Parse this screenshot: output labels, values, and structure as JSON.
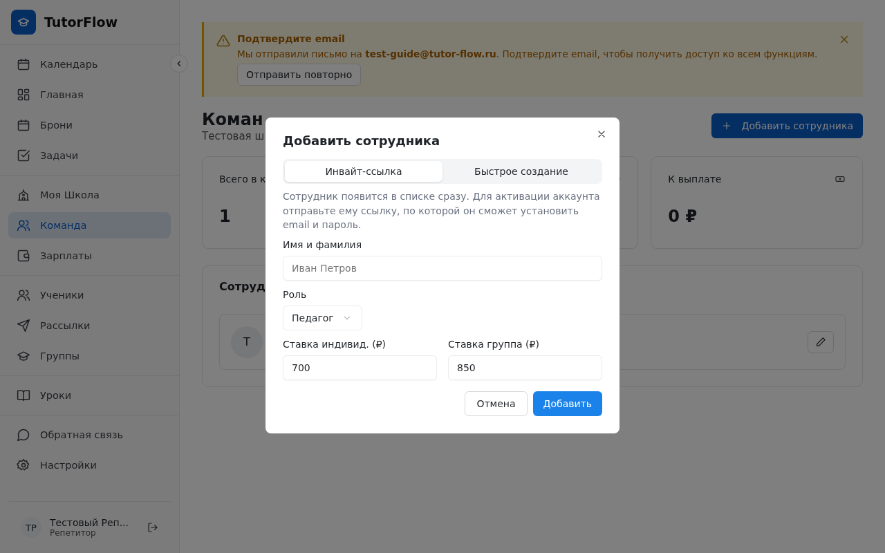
{
  "app": {
    "name": "TutorFlow"
  },
  "sidebar": {
    "sections": [
      {
        "items": [
          {
            "label": "Календарь",
            "selected": false
          },
          {
            "label": "Главная",
            "selected": false
          },
          {
            "label": "Брони",
            "selected": false
          },
          {
            "label": "Задачи",
            "selected": false
          }
        ]
      },
      {
        "items": [
          {
            "label": "Моя Школа",
            "selected": false
          },
          {
            "label": "Команда",
            "selected": true
          },
          {
            "label": "Зарплаты",
            "selected": false
          }
        ]
      },
      {
        "items": [
          {
            "label": "Ученики",
            "selected": false
          },
          {
            "label": "Рассылки",
            "selected": false
          },
          {
            "label": "Группы",
            "selected": false
          }
        ]
      },
      {
        "items": [
          {
            "label": "Уроки",
            "selected": false
          }
        ]
      },
      {
        "items": [
          {
            "label": "Обратная связь",
            "selected": false
          },
          {
            "label": "Настройки",
            "selected": false
          }
        ]
      }
    ],
    "user": {
      "initials": "TP",
      "name": "Тестовый Реп...",
      "role": "Репетитор"
    }
  },
  "banner": {
    "title": "Подтвердите email",
    "message": "Мы отправили письмо на **test-guide@tutor-flow.ru**. Подтвердите email, чтобы получить доступ ко всем функциям.",
    "button": "Отправить повторно"
  },
  "page": {
    "title": "Коман",
    "subtitle": "Тестовая ш",
    "add_button": "Добавить сотрудника"
  },
  "stats": [
    {
      "kind": "metric",
      "label": "Всего в к",
      "value": "1"
    },
    {
      "kind": "covered"
    },
    {
      "kind": "metric",
      "label": "К выплате",
      "value": "0 ₽"
    }
  ],
  "employees": {
    "title": "Сотруд",
    "rows": [
      {
        "initials": "Т"
      }
    ]
  },
  "modal": {
    "title": "Добавить сотрудника",
    "tabs": [
      {
        "label": "Инвайт-ссылка",
        "selected": true
      },
      {
        "label": "Быстрое создание",
        "selected": false
      }
    ],
    "description": "Сотрудник появится в списке сразу. Для активации аккаунта отправьте ему ссылку, по которой он сможет установить email и пароль.",
    "fields": [
      {
        "kind": "text",
        "label": "Имя и фамилия",
        "placeholder": "Иван Петров"
      },
      {
        "kind": "select",
        "label": "Роль",
        "value": "Педагог"
      }
    ],
    "rate_fields": [
      {
        "label": "Ставка индивид. (₽)",
        "value": "700"
      },
      {
        "label": "Ставка группа (₽)",
        "value": "850"
      }
    ],
    "buttons": [
      {
        "kind": "secondary",
        "label": "Отмена"
      },
      {
        "kind": "primary",
        "label": "Добавить"
      }
    ]
  }
}
